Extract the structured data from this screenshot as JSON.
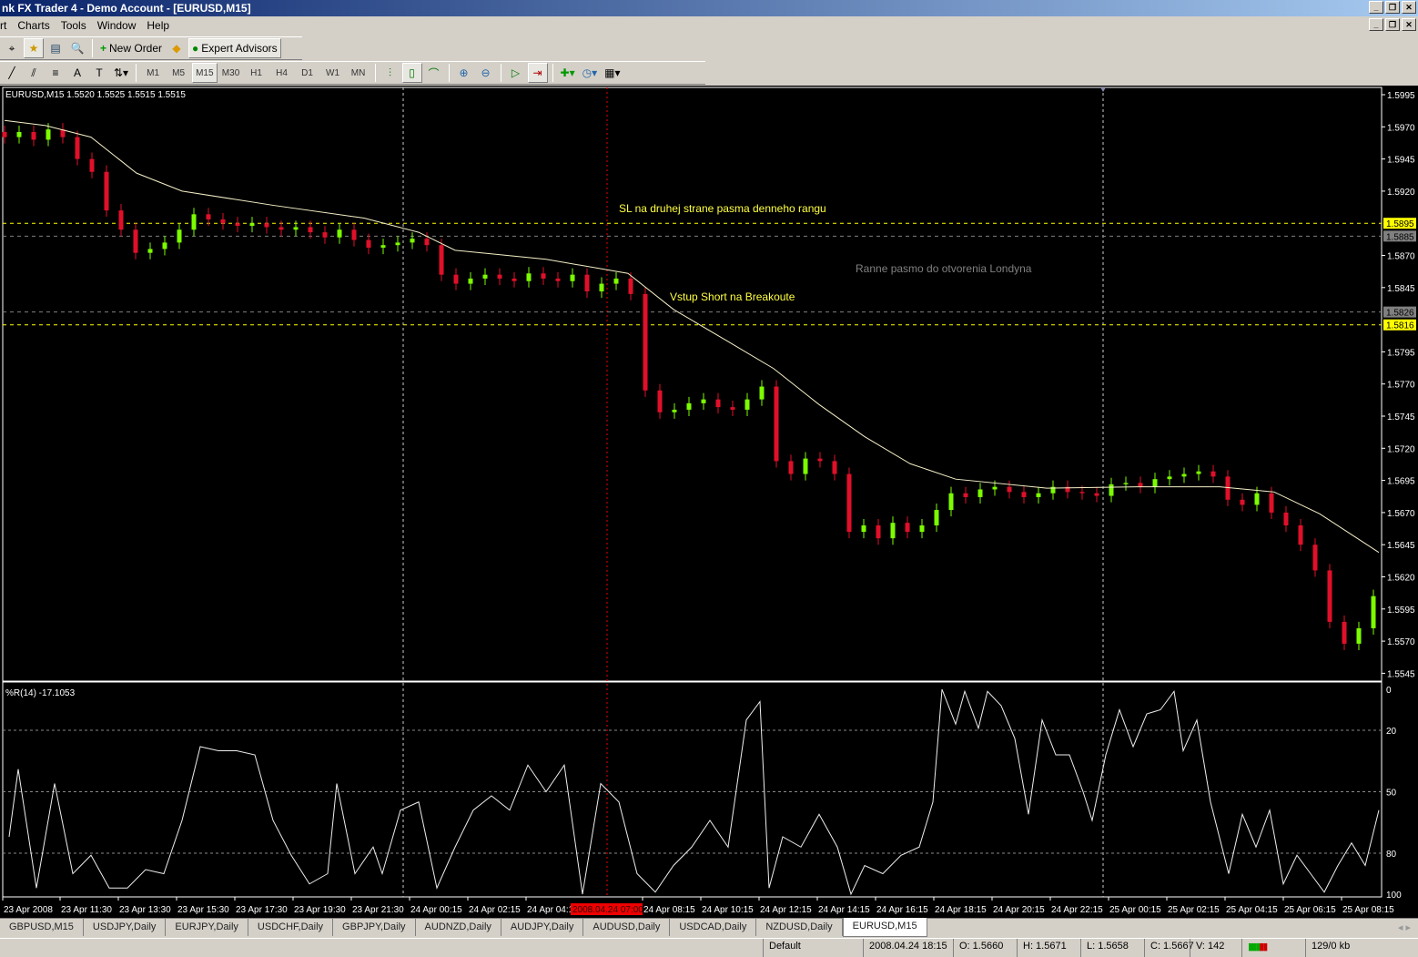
{
  "window": {
    "title": "nk FX Trader 4 - Demo Account - [EURUSD,M15]"
  },
  "menu": [
    "rt",
    "Charts",
    "Tools",
    "Window",
    "Help"
  ],
  "toolbar": {
    "new_order": "New Order",
    "expert_advisors": "Expert Advisors",
    "timeframes": [
      "M1",
      "M5",
      "M15",
      "M30",
      "H1",
      "H4",
      "D1",
      "W1",
      "MN"
    ],
    "active_timeframe": "M15"
  },
  "chart": {
    "header": "EURUSD,M15  1.5520 1.5525 1.5515 1.5515",
    "indicator_header": "%R(14) -17.1053",
    "annotations": {
      "sl": "SL na druhej strane pasma denneho rangu",
      "range": "Ranne pasmo do otvorenia Londyna",
      "entry": "Vstup Short na Breakoute"
    },
    "colors": {
      "bull": "#7cfc00",
      "bear": "#e0102a",
      "ma": "#f5f0c8",
      "annotation": "#ffff40",
      "range_text": "#808080"
    }
  },
  "chart_data": {
    "type": "candlestick",
    "symbol": "EURUSD",
    "timeframe": "M15",
    "ylim": [
      1.5537,
      1.6003
    ],
    "y_ticks": [
      "1.5995",
      "1.5970",
      "1.5945",
      "1.5920",
      "1.5870",
      "1.5845",
      "1.5795",
      "1.5770",
      "1.5745",
      "1.5720",
      "1.5695",
      "1.5670",
      "1.5645",
      "1.5620",
      "1.5595",
      "1.5570",
      "1.5545"
    ],
    "levels": [
      {
        "price": "1.5895",
        "color": "#ffff00",
        "kind": "sl"
      },
      {
        "price": "1.5885",
        "color": "#808080",
        "kind": "range"
      },
      {
        "price": "1.5826",
        "color": "#808080",
        "kind": "range"
      },
      {
        "price": "1.5816",
        "color": "#ffff00",
        "kind": "entry"
      }
    ],
    "closes": [
      1.5962,
      1.5966,
      1.596,
      1.5968,
      1.5962,
      1.5945,
      1.5935,
      1.5905,
      1.589,
      1.5872,
      1.5875,
      1.588,
      1.589,
      1.5902,
      1.5898,
      1.5895,
      1.5893,
      1.5895,
      1.5892,
      1.589,
      1.5892,
      1.5888,
      1.5884,
      1.589,
      1.5882,
      1.5876,
      1.5878,
      1.588,
      1.5883,
      1.5878,
      1.5855,
      1.5848,
      1.5852,
      1.5855,
      1.5852,
      1.585,
      1.5856,
      1.5852,
      1.585,
      1.5855,
      1.5842,
      1.5848,
      1.5852,
      1.584,
      1.5765,
      1.5748,
      1.575,
      1.5755,
      1.5758,
      1.5752,
      1.575,
      1.5758,
      1.5768,
      1.571,
      1.57,
      1.5712,
      1.571,
      1.57,
      1.5655,
      1.566,
      1.565,
      1.5662,
      1.5655,
      1.566,
      1.5672,
      1.5685,
      1.5682,
      1.5688,
      1.569,
      1.5686,
      1.5682,
      1.5685,
      1.569,
      1.5686,
      1.5685,
      1.5683,
      1.5692,
      1.5693,
      1.569,
      1.5696,
      1.5698,
      1.57,
      1.5702,
      1.5698,
      1.568,
      1.5676,
      1.5685,
      1.567,
      1.566,
      1.5645,
      1.5625,
      1.5585,
      1.5568,
      1.558,
      1.5605
    ],
    "ma": [
      1.5975,
      1.5971,
      1.5962,
      1.5934,
      1.592,
      1.5909,
      1.5899,
      1.5888,
      1.5874,
      1.5867,
      1.5856,
      1.5828,
      1.5803,
      1.5782,
      1.5754,
      1.5729,
      1.5708,
      1.5696,
      1.5689,
      1.569,
      1.569,
      1.5686,
      1.5669,
      1.5639
    ],
    "williams_r": {
      "ylim": [
        -100,
        0
      ],
      "ticks": [
        "0",
        "20",
        "50",
        "80",
        "100"
      ],
      "values": [
        -72,
        -39,
        -97,
        -46,
        -90,
        -81,
        -97,
        -97,
        -88,
        -90,
        -64,
        -28,
        -30,
        -30,
        -32,
        -64,
        -81,
        -95,
        -90,
        -46,
        -90,
        -77,
        -90,
        -59,
        -55,
        -97,
        -77,
        -59,
        -52,
        -59,
        -37,
        -50,
        -37,
        -100,
        -46,
        -55,
        -90,
        -99,
        -86,
        -77,
        -64,
        -77,
        -15,
        -6,
        -97,
        -72,
        -77,
        -61,
        -77,
        -100,
        -86,
        -90,
        -81,
        -77,
        -55,
        0,
        -17,
        -1,
        -19,
        -1,
        -8,
        -24,
        -61,
        -15,
        -32,
        -32,
        -50,
        -64,
        -32,
        -10,
        -28,
        -12,
        -10,
        -1,
        -30,
        -15,
        -55,
        -90,
        -61,
        -77,
        -59,
        -95,
        -81,
        -90,
        -99,
        -86,
        -75,
        -86,
        -59
      ]
    },
    "x_labels": [
      "23 Apr 2008",
      "23 Apr 11:30",
      "23 Apr 13:30",
      "23 Apr 15:30",
      "23 Apr 17:30",
      "23 Apr 19:30",
      "23 Apr 21:30",
      "24 Apr 00:15",
      "24 Apr 02:15",
      "24 Apr 04:15",
      "24 Apr 08:15",
      "24 Apr 10:15",
      "24 Apr 12:15",
      "24 Apr 14:15",
      "24 Apr 16:15",
      "24 Apr 18:15",
      "24 Apr 20:15",
      "24 Apr 22:15",
      "25 Apr 00:15",
      "25 Apr 02:15",
      "25 Apr 04:15",
      "25 Apr 06:15",
      "25 Apr 08:15"
    ],
    "cursor_time": "2008.04.24 07:00"
  },
  "tabs": [
    "GBPUSD,M15",
    "USDJPY,Daily",
    "EURJPY,Daily",
    "USDCHF,Daily",
    "GBPJPY,Daily",
    "AUDNZD,Daily",
    "AUDJPY,Daily",
    "AUDUSD,Daily",
    "USDCAD,Daily",
    "NZDUSD,Daily",
    "EURUSD,M15"
  ],
  "active_tab": "EURUSD,M15",
  "status": {
    "profile": "Default",
    "time": "2008.04.24 18:15",
    "open": "O: 1.5660",
    "high": "H: 1.5671",
    "low": "L: 1.5658",
    "close": "C: 1.5667",
    "volume": "V: 142",
    "traffic": "129/0 kb"
  }
}
